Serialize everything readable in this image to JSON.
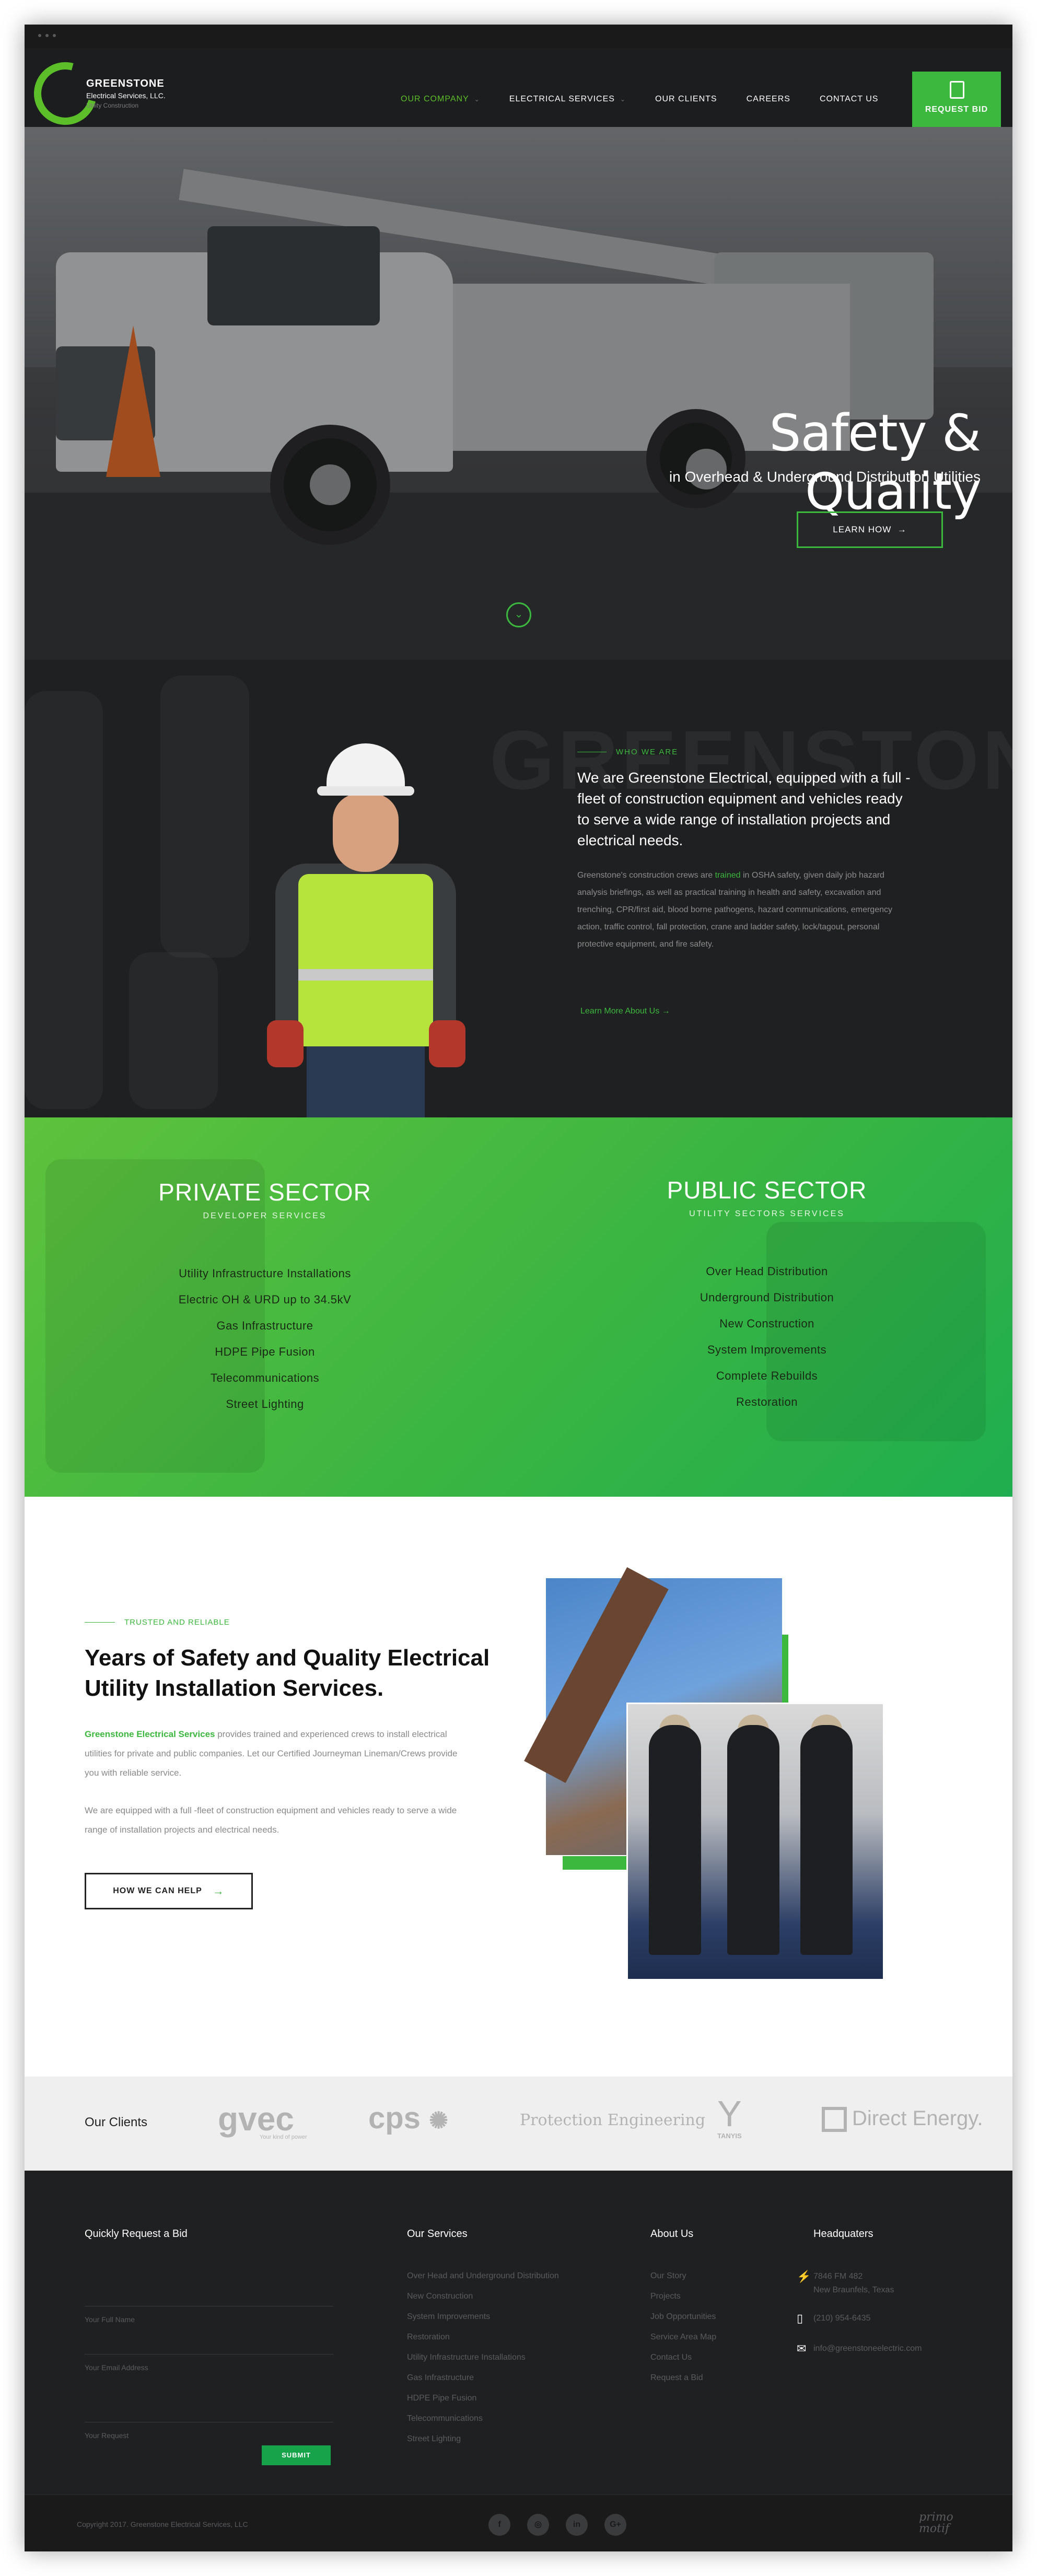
{
  "nav": {
    "brand_name": "GREENSTONE",
    "brand_sub": "Electrical Services, LLC.",
    "brand_tag": "Utility Construction",
    "items": [
      {
        "label": "OUR COMPANY",
        "has_dropdown": true,
        "active": true
      },
      {
        "label": "ELECTRICAL SERVICES",
        "has_dropdown": true,
        "active": false
      },
      {
        "label": "OUR CLIENTS",
        "has_dropdown": false,
        "active": false
      },
      {
        "label": "CAREERS",
        "has_dropdown": false,
        "active": false
      },
      {
        "label": "CONTACT US",
        "has_dropdown": false,
        "active": false
      }
    ],
    "request_bid": "REQUEST BID",
    "request_icon": "document-icon"
  },
  "hero": {
    "title": "Safety & Quality",
    "subtitle": "in Overhead & Underground Distribution Utilities",
    "cta": "LEARN HOW",
    "cta_icon": "arrow-right-icon",
    "scroll_icon": "chevron-down-icon"
  },
  "about": {
    "watermark": "GREENSTONE",
    "eyebrow": "WHO WE ARE",
    "heading": "We are Greenstone Electrical, equipped with a full -fleet of construction equipment and vehicles ready to serve a wide range of installation projects and electrical needs.",
    "body_pre": "Greenstone's construction crews are ",
    "body_hl": "trained",
    "body_post": " in OSHA safety, given daily job hazard analysis briefings, as well as practical training in health and safety, excavation and trenching, CPR/first aid, blood borne pathogens, hazard communications, emergency action, traffic control, fall protection, crane and ladder safety, lock/tagout, personal protective equipment, and fire safety.",
    "more": "Learn More About Us  →"
  },
  "sectors": {
    "private": {
      "title": "PRIVATE SECTOR",
      "sub": "DEVELOPER SERVICES",
      "items": [
        "Utility Infrastructure Installations",
        "Electric OH & URD up to 34.5kV",
        "Gas Infrastructure",
        "HDPE Pipe Fusion",
        "Telecommunications",
        "Street Lighting"
      ]
    },
    "public": {
      "title": "PUBLIC SECTOR",
      "sub": "UTILITY SECTORS SERVICES",
      "items": [
        "Over Head Distribution",
        "Underground Distribution",
        "New Construction",
        "System Improvements",
        "Complete Rebuilds",
        "Restoration"
      ]
    }
  },
  "years": {
    "eyebrow": "TRUSTED AND RELIABLE",
    "heading": "Years of Safety and Quality Electrical Utility Installation Services.",
    "p1_hl": "Greenstone Electrical Services",
    "p1_rest": " provides trained and experienced crews to install electrical utilities for private and public companies. Let our Certified Journeyman Lineman/Crews provide you with reliable service.",
    "p2": "We are equipped with a full -fleet of construction equipment and vehicles ready to serve a wide range of installation projects and electrical needs.",
    "cta": "HOW WE CAN HELP",
    "cta_arrow": "→"
  },
  "clients": {
    "label": "Our Clients",
    "logos": [
      "gvec",
      "Your kind of power",
      "cps",
      "Protection Engineering",
      "TANYIS",
      "Direct Energy."
    ]
  },
  "footer": {
    "bid": {
      "title": "Quickly Request a Bid",
      "name_ph": "Your Full Name",
      "email_ph": "Your Email Address",
      "request_ph": "Your Request",
      "submit": "SUBMIT"
    },
    "services": {
      "title": "Our Services",
      "items": [
        "Over Head and Underground Distribution",
        "New Construction",
        "System Improvements",
        "Restoration",
        "Utility Infrastructure Installations",
        "Gas Infrastructure",
        "HDPE Pipe Fusion",
        "Telecommunications",
        "Street Lighting"
      ]
    },
    "about": {
      "title": "About Us",
      "items": [
        "Our Story",
        "Projects",
        "Job Opportunities",
        "Service Area Map",
        "Contact Us",
        "Request a Bid"
      ]
    },
    "hq": {
      "title": "Headquaters",
      "addr1": "7846 FM 482",
      "addr2": "New Braunfels, Texas",
      "phone": "(210) 954-6435",
      "email": "info@greenstoneelectric.com"
    }
  },
  "bottom": {
    "copyright": "Copyright 2017. Greenstone Electrical Services, LLC",
    "social": [
      "f",
      "◎",
      "in",
      "G+"
    ],
    "credit1": "primo",
    "credit2": "motif"
  }
}
